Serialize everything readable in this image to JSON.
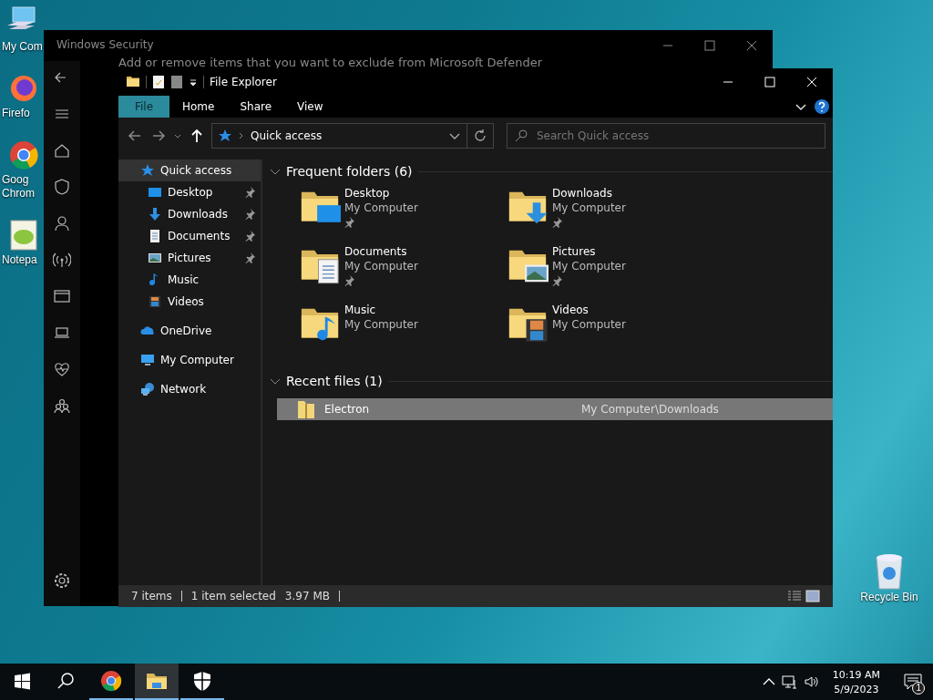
{
  "desktop": {
    "icons": [
      {
        "kind": "computer",
        "label": "My Com"
      },
      {
        "kind": "firefox",
        "label": "Firefo"
      },
      {
        "kind": "chrome",
        "label": "Goog Chrom"
      },
      {
        "kind": "notepad",
        "label": "Notepa"
      }
    ],
    "recycle_bin": {
      "label": "Recycle Bin"
    }
  },
  "security_window": {
    "title": "Windows Security",
    "subtitle": "Add or remove items that you want to exclude from Microsoft Defender"
  },
  "explorer": {
    "title": "File Explorer",
    "ribbon_tabs": [
      {
        "label": "File",
        "selected": true
      },
      {
        "label": "Home",
        "selected": false
      },
      {
        "label": "Share",
        "selected": false
      },
      {
        "label": "View",
        "selected": false
      }
    ],
    "address": "Quick access",
    "search": {
      "placeholder": "Search Quick access"
    },
    "nav": [
      {
        "kind": "quick",
        "label": "Quick access",
        "selected": true,
        "children": [
          {
            "kind": "desktop",
            "label": "Desktop",
            "pinned": true
          },
          {
            "kind": "downloads",
            "label": "Downloads",
            "pinned": true
          },
          {
            "kind": "documents",
            "label": "Documents",
            "pinned": true
          },
          {
            "kind": "pictures",
            "label": "Pictures",
            "pinned": true
          },
          {
            "kind": "music",
            "label": "Music",
            "pinned": false
          },
          {
            "kind": "videos",
            "label": "Videos",
            "pinned": false
          }
        ]
      },
      {
        "kind": "onedrive",
        "label": "OneDrive",
        "selected": false
      },
      {
        "kind": "computer",
        "label": "My Computer",
        "selected": false
      },
      {
        "kind": "network",
        "label": "Network",
        "selected": false
      }
    ],
    "frequent": {
      "heading": "Frequent folders (6)",
      "expanded": true,
      "items": [
        {
          "kind": "desktop",
          "name": "Desktop",
          "location": "My Computer",
          "pinned": true
        },
        {
          "kind": "downloads",
          "name": "Downloads",
          "location": "My Computer",
          "pinned": true
        },
        {
          "kind": "documents",
          "name": "Documents",
          "location": "My Computer",
          "pinned": true
        },
        {
          "kind": "pictures",
          "name": "Pictures",
          "location": "My Computer",
          "pinned": true
        },
        {
          "kind": "music",
          "name": "Music",
          "location": "My Computer",
          "pinned": false
        },
        {
          "kind": "videos",
          "name": "Videos",
          "location": "My Computer",
          "pinned": false
        }
      ]
    },
    "recent": {
      "heading": "Recent files (1)",
      "expanded": true,
      "items": [
        {
          "name": "Electron",
          "path": "My Computer\\Downloads",
          "selected": true
        }
      ]
    },
    "status": {
      "count": "7 items",
      "selection": "1 item selected",
      "size": "3.97 MB"
    }
  },
  "taskbar": {
    "apps": [
      {
        "kind": "chrome",
        "running": true,
        "selected": false
      },
      {
        "kind": "explorer",
        "running": true,
        "selected": true
      },
      {
        "kind": "security",
        "running": true,
        "selected": false
      }
    ],
    "time": "10:19 AM",
    "date": "5/9/2023",
    "notifications": "1"
  }
}
